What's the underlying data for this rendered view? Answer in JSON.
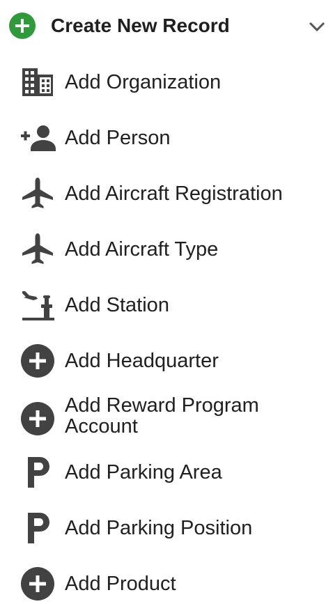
{
  "header": {
    "title": "Create New Record",
    "icon": "add-circle-icon",
    "accent_color": "#2e9a3a",
    "chevron_icon": "chevron-down-icon"
  },
  "items": [
    {
      "label": "Add Organization",
      "icon": "building-icon"
    },
    {
      "label": "Add Person",
      "icon": "person-add-icon"
    },
    {
      "label": "Add Aircraft Registration",
      "icon": "airplane-icon"
    },
    {
      "label": "Add Aircraft Type",
      "icon": "airplane-icon"
    },
    {
      "label": "Add Station",
      "icon": "station-icon"
    },
    {
      "label": "Add Headquarter",
      "icon": "add-circle-icon"
    },
    {
      "label": "Add Reward Program Account",
      "icon": "add-circle-icon"
    },
    {
      "label": "Add Parking Area",
      "icon": "parking-icon"
    },
    {
      "label": "Add Parking Position",
      "icon": "parking-icon"
    },
    {
      "label": "Add Product",
      "icon": "add-circle-icon"
    }
  ],
  "icon_color": "#424242"
}
